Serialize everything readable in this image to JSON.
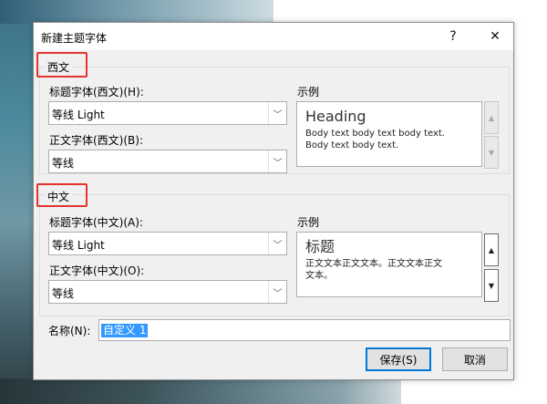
{
  "dialog": {
    "title": "新建主题字体",
    "help_label": "?",
    "close_label": "✕"
  },
  "western": {
    "group_label": "西文",
    "heading_font_label": "标题字体(西文)(H):",
    "heading_font_value": "等线 Light",
    "body_font_label": "正文字体(西文)(B):",
    "body_font_value": "等线",
    "sample_label": "示例",
    "sample_heading": "Heading",
    "sample_body_1": "Body text body text body text.",
    "sample_body_2": "Body text body text."
  },
  "eastasian": {
    "group_label": "中文",
    "heading_font_label": "标题字体(中文)(A):",
    "heading_font_value": "等线 Light",
    "body_font_label": "正文字体(中文)(O):",
    "body_font_value": "等线",
    "sample_label": "示例",
    "sample_heading": "标题",
    "sample_body_1": "正文文本正文文本。正文文本正文",
    "sample_body_2": "文本。"
  },
  "name": {
    "label": "名称(N):",
    "value": "自定义 1"
  },
  "buttons": {
    "save": "保存(S)",
    "cancel": "取消"
  },
  "icons": {
    "dropdown": "chevron-down-icon",
    "scroll_up": "triangle-up-icon",
    "scroll_down": "triangle-down-icon"
  },
  "colors": {
    "highlight_box": "#e5342f",
    "selection": "#3399ff",
    "default_button_border": "#0078d7"
  }
}
